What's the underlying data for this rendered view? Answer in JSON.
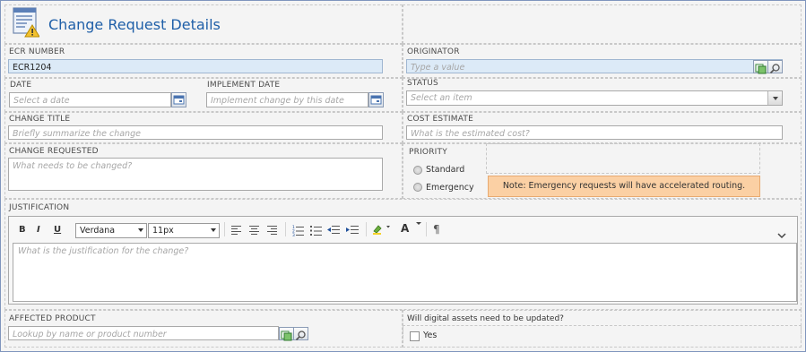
{
  "form": {
    "title": "Change Request Details",
    "title_icon": "form-warning-icon"
  },
  "fields": {
    "ecr_number": {
      "label": "ECR NUMBER",
      "value": "ECR1204"
    },
    "originator": {
      "label": "ORIGINATOR",
      "placeholder": "Type a value"
    },
    "date": {
      "label": "DATE",
      "placeholder": "Select a date"
    },
    "implement_date": {
      "label": "IMPLEMENT DATE",
      "placeholder": "Implement change by this date"
    },
    "status": {
      "label": "STATUS",
      "placeholder": "Select an item"
    },
    "change_title": {
      "label": "CHANGE TITLE",
      "placeholder": "Briefly summarize the change"
    },
    "cost_estimate": {
      "label": "COST ESTIMATE",
      "placeholder": "What is the estimated cost?"
    },
    "change_requested": {
      "label": "CHANGE REQUESTED",
      "placeholder": "What needs to be changed?"
    },
    "priority": {
      "label": "PRIORITY",
      "options": [
        "Standard",
        "Emergency"
      ],
      "note": "Note: Emergency requests will have accelerated routing."
    },
    "justification": {
      "label": "JUSTIFICATION",
      "placeholder": "What is the justification for the change?",
      "toolbar": {
        "bold": "B",
        "italic": "I",
        "underline": "U",
        "font_family": "Verdana",
        "font_size": "11px",
        "font_color": "A",
        "paragraph": "¶"
      }
    },
    "affected_product": {
      "label": "AFFECTED PRODUCT",
      "placeholder": "Lookup by name or product number"
    },
    "digital_assets": {
      "label": "Will digital assets need to be updated?",
      "option": "Yes"
    }
  },
  "colors": {
    "title": "#1f5fa8",
    "note_bg": "#fbd0a4",
    "frame_border": "#7f95bd",
    "value_bg": "#dceaf7"
  }
}
